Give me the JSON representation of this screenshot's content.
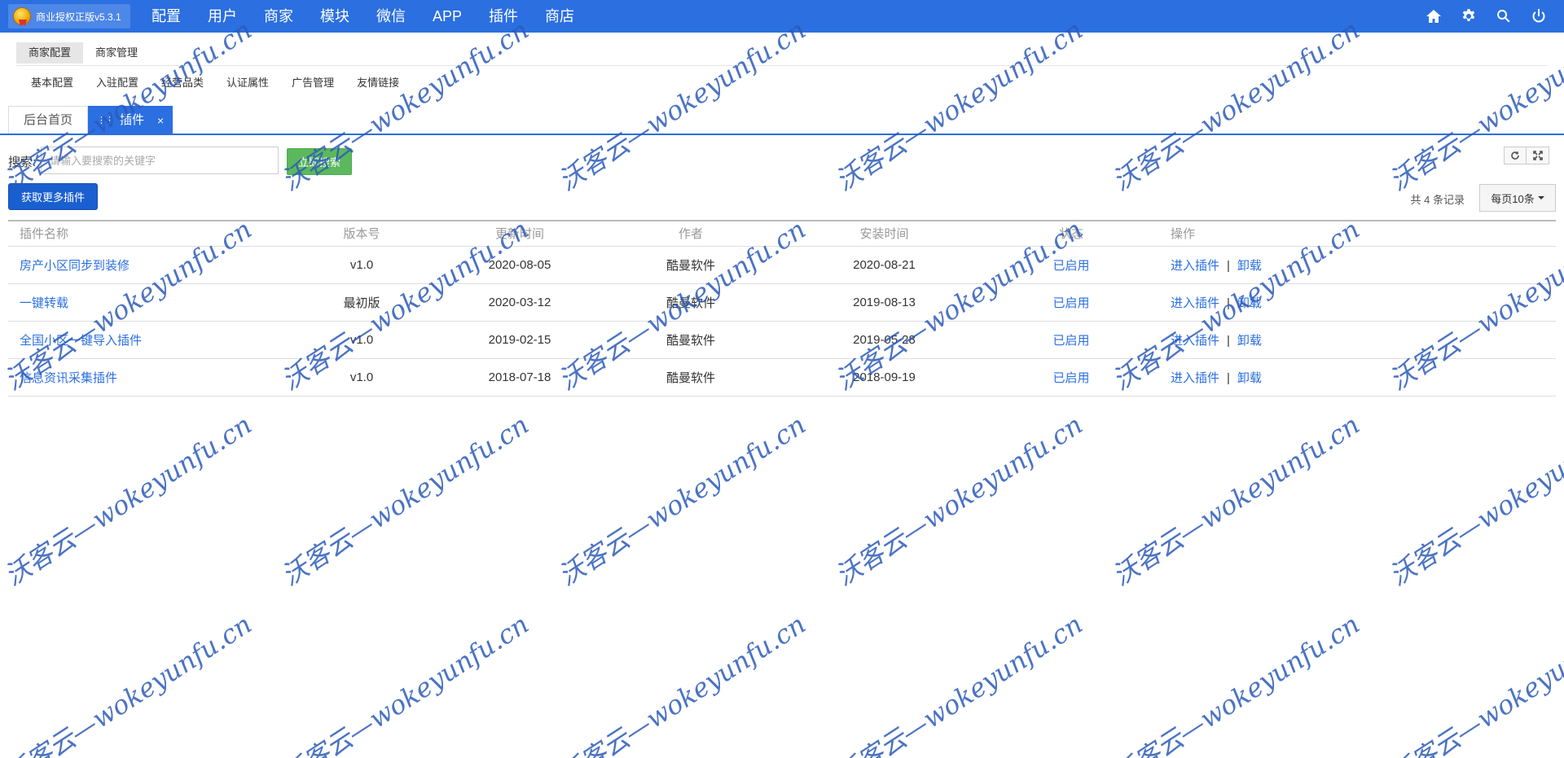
{
  "app": {
    "logo_text": "商业授权正版v5.3.1",
    "nav": [
      "配置",
      "用户",
      "商家",
      "模块",
      "微信",
      "APP",
      "插件",
      "商店"
    ],
    "icons": [
      "home-icon",
      "gear-icon",
      "search-icon",
      "power-icon"
    ]
  },
  "submenu": {
    "level1": [
      "商家配置",
      "商家管理"
    ],
    "level2": [
      "基本配置",
      "入驻配置",
      "经营品类",
      "认证属性",
      "广告管理",
      "友情链接"
    ]
  },
  "tabs": {
    "home": "后台首页",
    "active": "插件",
    "close": "×"
  },
  "toolbar": {
    "search_label": "搜索:",
    "search_placeholder": "请输入要搜索的关键字",
    "search_button": "立即搜索",
    "more_button": "获取更多插件",
    "record_count": "共 4 条记录",
    "per_page": "每页10条"
  },
  "table": {
    "headers": [
      "插件名称",
      "版本号",
      "更新时间",
      "作者",
      "安装时间",
      "状态",
      "操作"
    ],
    "rows": [
      {
        "name": "房产小区同步到装修",
        "version": "v1.0",
        "updated": "2020-08-05",
        "author": "酷曼软件",
        "installed": "2020-08-21",
        "status": "已启用",
        "enter": "进入插件",
        "uninstall": "卸载"
      },
      {
        "name": "一键转载",
        "version": "最初版",
        "updated": "2020-03-12",
        "author": "酷曼软件",
        "installed": "2019-08-13",
        "status": "已启用",
        "enter": "进入插件",
        "uninstall": "卸载"
      },
      {
        "name": "全国小区一键导入插件",
        "version": "v1.0",
        "updated": "2019-02-15",
        "author": "酷曼软件",
        "installed": "2019-05-28",
        "status": "已启用",
        "enter": "进入插件",
        "uninstall": "卸载"
      },
      {
        "name": "信息资讯采集插件",
        "version": "v1.0",
        "updated": "2018-07-18",
        "author": "酷曼软件",
        "installed": "2018-09-19",
        "status": "已启用",
        "enter": "进入插件",
        "uninstall": "卸载"
      }
    ],
    "separator": "|"
  },
  "watermark": {
    "text": "沃客云—wokeyunfu.cn"
  },
  "colors": {
    "primary": "#2b6fe0",
    "success": "#5cb85c",
    "link": "#2b6fe0",
    "watermark": "#2c5bb8"
  }
}
